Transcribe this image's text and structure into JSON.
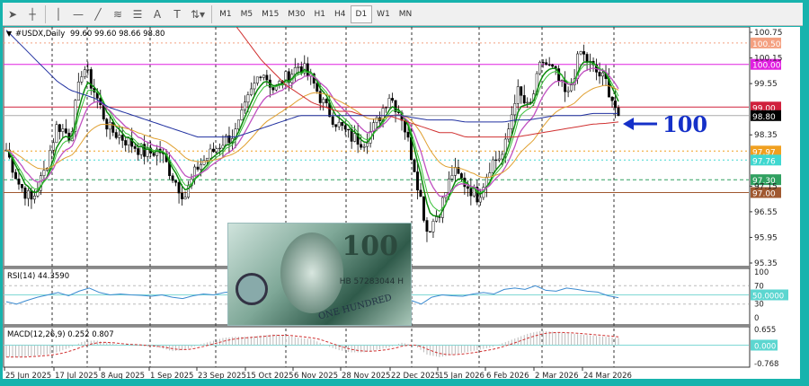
{
  "toolbar": {
    "tools": [
      {
        "icon": "cursor-icon",
        "g": "➤"
      },
      {
        "icon": "crosshair-icon",
        "g": "┼"
      },
      {
        "icon": "vertical-line-icon",
        "g": "│"
      },
      {
        "icon": "horizontal-line-icon",
        "g": "—"
      },
      {
        "icon": "trendline-icon",
        "g": "╱"
      },
      {
        "icon": "equidistant-channel-icon",
        "g": "≋"
      },
      {
        "icon": "fibonacci-icon",
        "g": "☰"
      },
      {
        "icon": "text-icon",
        "g": "A"
      },
      {
        "icon": "text-label-icon",
        "g": "T"
      },
      {
        "icon": "arrows-icon",
        "g": "⇅▾"
      }
    ],
    "timeframes": [
      "M1",
      "M5",
      "M15",
      "M30",
      "H1",
      "H4",
      "D1",
      "W1",
      "MN"
    ],
    "active_timeframe": "D1"
  },
  "chart": {
    "symbol_label": "#USDX,Daily",
    "ohlc": "99.60 99.60 98.66 98.80",
    "annotation": "100",
    "annotation_color": "#1530c8",
    "image_text": {
      "denomination": "100",
      "serial": "HB 57283044 H",
      "banner": "ONE HUNDRED"
    }
  },
  "chart_data": {
    "type": "candlestick",
    "price_axis": {
      "ticks": [
        "100.75",
        "100.15",
        "99.55",
        "98.35",
        "97.15",
        "96.55",
        "95.95",
        "95.35"
      ],
      "ylim": [
        95.35,
        100.75
      ]
    },
    "date_labels": [
      "25 Jun 2025",
      "17 Jul 2025",
      "8 Aug 2025",
      "1 Sep 2025",
      "23 Sep 2025",
      "15 Oct 2025",
      "6 Nov 2025",
      "28 Nov 2025",
      "22 Dec 2025",
      "15 Jan 2026",
      "6 Feb 2026",
      "2 Mar 2026",
      "24 Mar 2026"
    ],
    "close_path": [
      98.0,
      97.2,
      96.8,
      97.5,
      98.6,
      98.3,
      100.0,
      99.3,
      98.5,
      98.3,
      98.1,
      97.9,
      98.0,
      97.4,
      96.9,
      97.6,
      97.9,
      98.2,
      98.4,
      99.2,
      99.9,
      99.4,
      99.7,
      100.0,
      99.6,
      99.0,
      98.6,
      98.3,
      98.2,
      98.6,
      99.3,
      98.8,
      97.6,
      96.1,
      96.6,
      97.5,
      97.2,
      96.9,
      97.7,
      97.9,
      99.4,
      98.9,
      100.1,
      99.8,
      99.2,
      100.3,
      99.9,
      99.6,
      98.8
    ],
    "ma_red": [
      null,
      null,
      null,
      null,
      null,
      null,
      null,
      null,
      null,
      null,
      null,
      null,
      null,
      null,
      null,
      null,
      null,
      101.2,
      100.9,
      100.5,
      100.1,
      99.8,
      99.5,
      99.3,
      99.1,
      99.0,
      98.9,
      98.9,
      98.8,
      98.8,
      98.8,
      98.7,
      98.6,
      98.5,
      98.4,
      98.4,
      98.3,
      98.3,
      98.3,
      98.3,
      98.3,
      98.35,
      98.4,
      98.45,
      98.5,
      98.55,
      98.6,
      98.62,
      98.65
    ],
    "ma_blue": [
      100.8,
      100.5,
      100.2,
      99.9,
      99.6,
      99.4,
      99.3,
      99.2,
      99.0,
      98.9,
      98.8,
      98.7,
      98.6,
      98.5,
      98.4,
      98.3,
      98.3,
      98.3,
      98.3,
      98.4,
      98.5,
      98.6,
      98.7,
      98.8,
      98.8,
      98.8,
      98.8,
      98.8,
      98.8,
      98.8,
      98.8,
      98.8,
      98.75,
      98.7,
      98.7,
      98.7,
      98.65,
      98.65,
      98.65,
      98.65,
      98.7,
      98.7,
      98.75,
      98.8,
      98.8,
      98.8,
      98.85,
      98.85,
      98.85
    ],
    "levels": [
      {
        "price": 100.5,
        "label": "100.50",
        "color": "#f4a080",
        "style": "dotted"
      },
      {
        "price": 100.0,
        "label": "100.00",
        "color": "#e020e0",
        "style": "solid"
      },
      {
        "price": 99.0,
        "label": "99.00",
        "color": "#d0203c",
        "style": "solid"
      },
      {
        "price": 98.8,
        "label": "98.80",
        "color": "#000000",
        "style": "solid"
      },
      {
        "price": 97.97,
        "label": "97.97",
        "color": "#f0a020",
        "style": "dotted"
      },
      {
        "price": 97.76,
        "label": "97.76",
        "color": "#40d8d0",
        "style": "dotted"
      },
      {
        "price": 97.3,
        "label": "97.30",
        "color": "#30a060",
        "style": "dashed"
      },
      {
        "price": 97.0,
        "label": "97.00",
        "color": "#a05830",
        "style": "solid"
      }
    ],
    "rsi": {
      "label": "RSI(14) 44.3590",
      "ticks": [
        "100",
        "70",
        "30",
        "0"
      ],
      "level_label": "50.0000",
      "values": [
        35,
        30,
        38,
        45,
        50,
        55,
        48,
        58,
        65,
        55,
        50,
        52,
        50,
        49,
        47,
        50,
        45,
        42,
        48,
        52,
        50,
        55,
        58,
        62,
        60,
        55,
        58,
        60,
        55,
        45,
        40,
        45,
        50,
        55,
        58,
        56,
        60,
        58,
        48,
        38,
        30,
        45,
        50,
        48,
        47,
        52,
        55,
        52,
        62,
        65,
        62,
        70,
        60,
        58,
        65,
        62,
        58,
        56,
        48,
        44
      ]
    },
    "macd": {
      "label": "MACD(12,26,9) 0.252 0.807",
      "ticks": [
        "0.655",
        "-0.768"
      ],
      "zero_label": "0.000",
      "ylim": [
        -0.768,
        0.655
      ],
      "hist": [
        -0.5,
        -0.5,
        -0.45,
        -0.4,
        -0.3,
        -0.1,
        0.15,
        0.2,
        0.1,
        0,
        0,
        -0.05,
        -0.1,
        -0.25,
        -0.2,
        0,
        0.15,
        0.3,
        0.35,
        0.35,
        0.4,
        0.45,
        0.4,
        0.3,
        0.25,
        0,
        -0.2,
        -0.3,
        -0.3,
        -0.2,
        -0.1,
        0.1,
        0,
        -0.4,
        -0.5,
        -0.4,
        -0.3,
        -0.2,
        -0.1,
        0.1,
        0.3,
        0.5,
        0.6,
        0.55,
        0.5,
        0.45,
        0.4,
        0.35,
        0.3
      ]
    }
  }
}
